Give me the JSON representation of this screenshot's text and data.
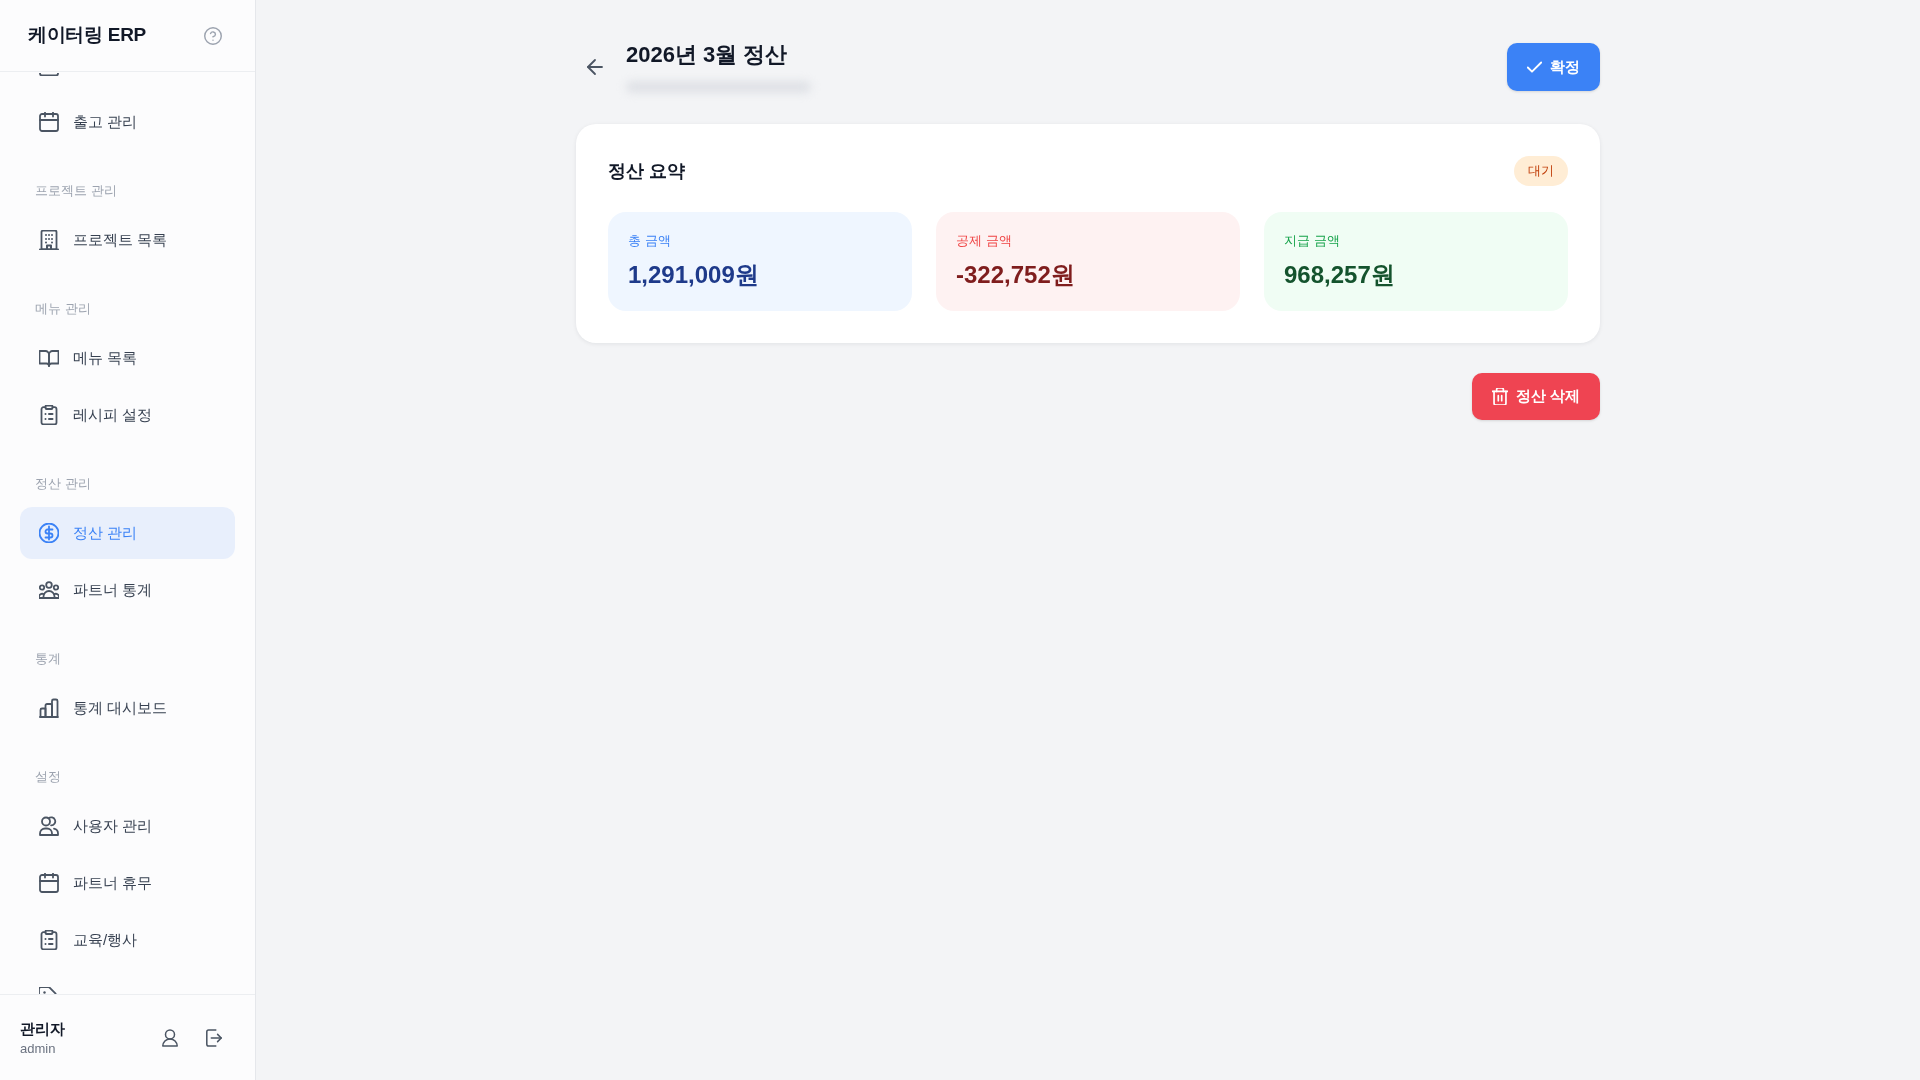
{
  "sidebar": {
    "title": "케이터링 ERP",
    "sections": [
      {
        "items": [
          {
            "label": "출고 관리",
            "selected": false
          }
        ]
      },
      {
        "heading": "프로젝트 관리",
        "items": [
          {
            "label": "프로젝트 목록",
            "selected": false
          }
        ]
      },
      {
        "heading": "메뉴 관리",
        "items": [
          {
            "label": "메뉴 목록",
            "selected": false
          },
          {
            "label": "레시피 설정",
            "selected": false
          }
        ]
      },
      {
        "heading": "정산 관리",
        "items": [
          {
            "label": "정산 관리",
            "selected": true
          },
          {
            "label": "파트너 통계",
            "selected": false
          }
        ]
      },
      {
        "heading": "통계",
        "items": [
          {
            "label": "통계 대시보드",
            "selected": false
          }
        ]
      },
      {
        "heading": "설정",
        "items": [
          {
            "label": "사용자 관리",
            "selected": false
          },
          {
            "label": "파트너 휴무",
            "selected": false
          },
          {
            "label": "교육/행사",
            "selected": false
          }
        ]
      }
    ],
    "user": {
      "name": "관리자",
      "username": "admin"
    }
  },
  "page": {
    "title": "2026년 3월 정산",
    "confirm_button": "확정",
    "summary": {
      "title": "정산 요약",
      "status": {
        "label": "대기",
        "kind": "pending"
      },
      "stats": [
        {
          "kind": "total",
          "label": "총 금액",
          "value": "1,291,009원"
        },
        {
          "kind": "deduction",
          "label": "공제 금액",
          "value": "-322,752원"
        },
        {
          "kind": "payout",
          "label": "지급 금액",
          "value": "968,257원"
        }
      ]
    },
    "delete_button": "정산 삭제"
  }
}
